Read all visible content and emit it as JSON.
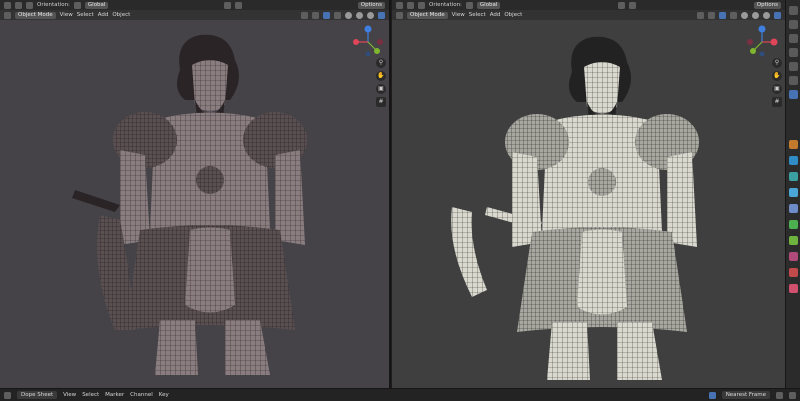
{
  "viewports": [
    {
      "orientation_label": "Orientation:",
      "orientation_value": "Global",
      "mode": "Object Mode",
      "menus": [
        "View",
        "Select",
        "Add",
        "Object"
      ],
      "options_label": "Options",
      "gizmo_axis": {
        "x": "X",
        "y": "Y",
        "z": "Z"
      }
    },
    {
      "orientation_label": "Orientation:",
      "orientation_value": "Global",
      "mode": "Object Mode",
      "menus": [
        "View",
        "Select",
        "Add",
        "Object"
      ],
      "options_label": "Options",
      "gizmo_axis": {
        "x": "X",
        "y": "Y",
        "z": "Z"
      }
    }
  ],
  "timeline": {
    "action": "Dope Sheet",
    "menus": [
      "View",
      "Select",
      "Marker",
      "Channel",
      "Key"
    ],
    "frame_mode": "Nearest Frame"
  },
  "colors": {
    "left_bg": "#454348",
    "right_bg": "#3f3f3f",
    "axis_x": "#e0455a",
    "axis_y": "#7fb52f",
    "axis_z": "#3f7fe0",
    "accent": "#4772b3"
  },
  "icons": [
    "cursor-icon",
    "move-icon",
    "zoom-icon",
    "hand-icon",
    "camera-icon",
    "grid-icon"
  ]
}
